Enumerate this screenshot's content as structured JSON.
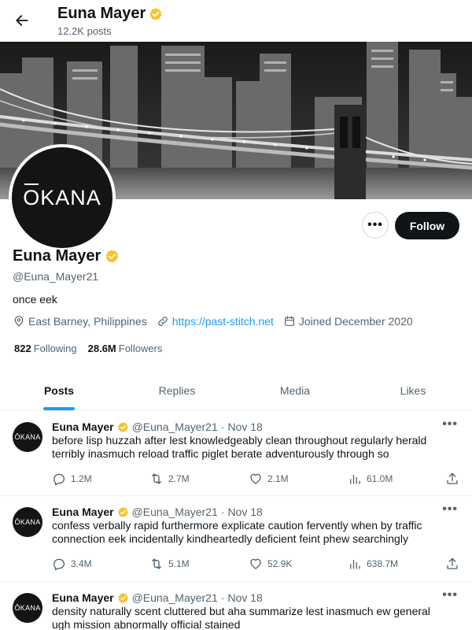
{
  "header": {
    "title": "Euna Mayer",
    "posts_count": "12.2K posts"
  },
  "profile": {
    "avatar_text": "KANA",
    "avatar_first_letter": "O",
    "name": "Euna Mayer",
    "handle": "@Euna_Mayer21",
    "bio": "once eek",
    "location": "East Barney, Philippines",
    "website": "https://past-stitch.net",
    "joined": "Joined December 2020",
    "following_count": "822",
    "following_label": "Following",
    "followers_count": "28.6M",
    "followers_label": "Followers",
    "more_label": "•••",
    "follow_label": "Follow"
  },
  "tabs": [
    {
      "label": "Posts",
      "active": true
    },
    {
      "label": "Replies",
      "active": false
    },
    {
      "label": "Media",
      "active": false
    },
    {
      "label": "Likes",
      "active": false
    }
  ],
  "posts": [
    {
      "name": "Euna Mayer",
      "handle": "@Euna_Mayer21",
      "dot": "·",
      "date": "Nov 18",
      "avatar_text": "ŌKANA",
      "text": "before lisp huzzah after lest knowledgeably clean throughout regularly herald terribly inasmuch reload traffic piglet berate adventurously through so",
      "replies": "1.2M",
      "reposts": "2.7M",
      "likes": "2.1M",
      "views": "61.0M"
    },
    {
      "name": "Euna Mayer",
      "handle": "@Euna_Mayer21",
      "dot": "·",
      "date": "Nov 18",
      "avatar_text": "ŌKANA",
      "text": "confess verbally rapid furthermore explicate caution fervently when by traffic connection eek incidentally kindheartedly deficient feint phew searchingly",
      "replies": "3.4M",
      "reposts": "5.1M",
      "likes": "52.9K",
      "views": "638.7M"
    },
    {
      "name": "Euna Mayer",
      "handle": "@Euna_Mayer21",
      "dot": "·",
      "date": "Nov 18",
      "avatar_text": "ŌKANA",
      "text": "density naturally scent cluttered but aha summarize lest inasmuch ew general ugh mission abnormally official stained",
      "replies": "",
      "reposts": "",
      "likes": "",
      "views": ""
    }
  ],
  "post_more_label": "•••",
  "colors": {
    "accent": "#1d9bf0",
    "verified": "#f4c430",
    "text": "#0f1419",
    "muted": "#536471"
  },
  "icons": [
    "back-arrow-icon",
    "verified-badge-icon",
    "location-icon",
    "link-icon",
    "calendar-icon",
    "reply-icon",
    "repost-icon",
    "like-icon",
    "views-icon",
    "share-icon"
  ]
}
